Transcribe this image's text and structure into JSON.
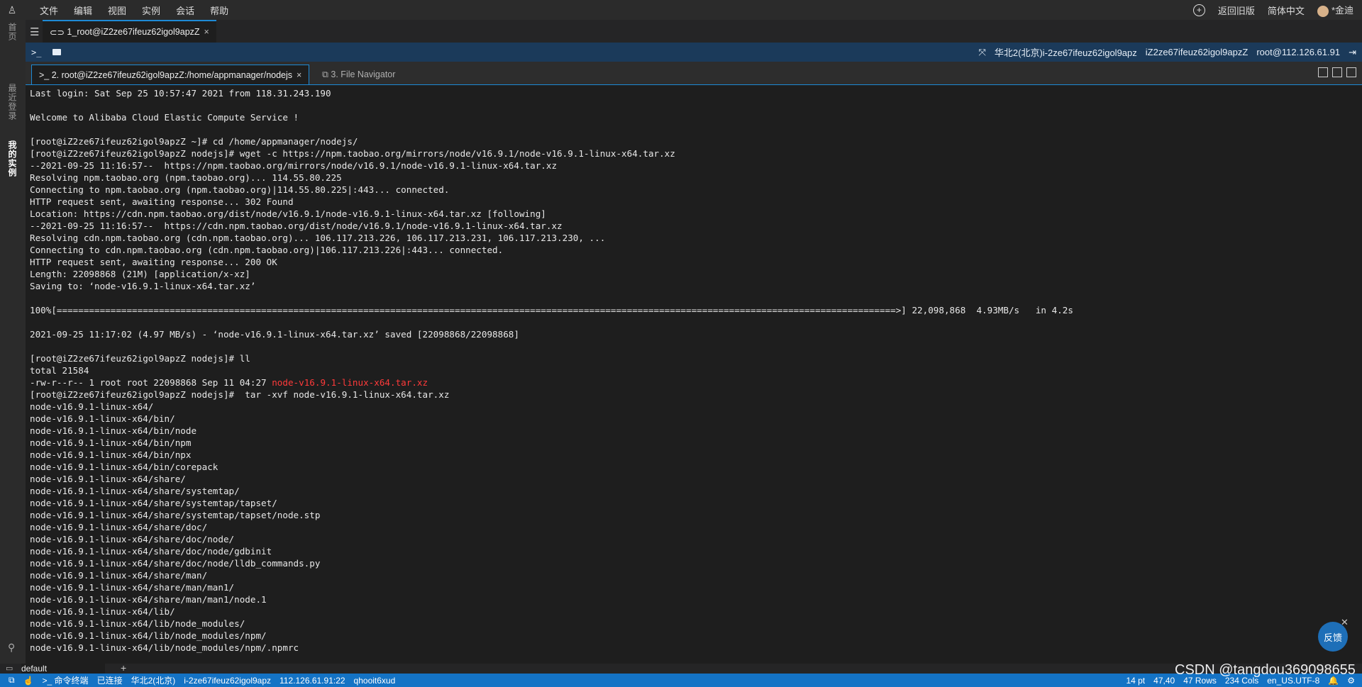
{
  "menubar": {
    "logo": "♙",
    "items": [
      "文件",
      "编辑",
      "视图",
      "实例",
      "会话",
      "帮助"
    ],
    "right": {
      "back_old": "返回旧版",
      "language": "简体中文",
      "user": "*金迪"
    }
  },
  "rail": {
    "home": "首页",
    "recent": "最近登录",
    "instances": "我的实例"
  },
  "session_tab": {
    "label": "1_root@iZ2ze67ifeuz62igol9apzZ"
  },
  "bluebar": {
    "region_instance": "华北2(北京)i-2ze67ifeuz62igol9apz",
    "hostname": "iZ2ze67ifeuz62igol9apzZ",
    "user_ip": "root@112.126.61.91"
  },
  "tabs": {
    "active": "2. root@iZ2ze67ifeuz62igol9apzZ:/home/appmanager/nodejs",
    "inactive": "3. File Navigator"
  },
  "terminal": {
    "lines": [
      "Last login: Sat Sep 25 10:57:47 2021 from 118.31.243.190",
      "",
      "Welcome to Alibaba Cloud Elastic Compute Service !",
      "",
      "[root@iZ2ze67ifeuz62igol9apzZ ~]# cd /home/appmanager/nodejs/",
      "[root@iZ2ze67ifeuz62igol9apzZ nodejs]# wget -c https://npm.taobao.org/mirrors/node/v16.9.1/node-v16.9.1-linux-x64.tar.xz",
      "--2021-09-25 11:16:57--  https://npm.taobao.org/mirrors/node/v16.9.1/node-v16.9.1-linux-x64.tar.xz",
      "Resolving npm.taobao.org (npm.taobao.org)... 114.55.80.225",
      "Connecting to npm.taobao.org (npm.taobao.org)|114.55.80.225|:443... connected.",
      "HTTP request sent, awaiting response... 302 Found",
      "Location: https://cdn.npm.taobao.org/dist/node/v16.9.1/node-v16.9.1-linux-x64.tar.xz [following]",
      "--2021-09-25 11:16:57--  https://cdn.npm.taobao.org/dist/node/v16.9.1/node-v16.9.1-linux-x64.tar.xz",
      "Resolving cdn.npm.taobao.org (cdn.npm.taobao.org)... 106.117.213.226, 106.117.213.231, 106.117.213.230, ...",
      "Connecting to cdn.npm.taobao.org (cdn.npm.taobao.org)|106.117.213.226|:443... connected.",
      "HTTP request sent, awaiting response... 200 OK",
      "Length: 22098868 (21M) [application/x-xz]",
      "Saving to: ‘node-v16.9.1-linux-x64.tar.xz’",
      "",
      "100%[============================================================================================================================================================>] 22,098,868  4.93MB/s   in 4.2s",
      "",
      "2021-09-25 11:17:02 (4.97 MB/s) - ‘node-v16.9.1-linux-x64.tar.xz’ saved [22098868/22098868]",
      "",
      "[root@iZ2ze67ifeuz62igol9apzZ nodejs]# ll",
      "total 21584",
      "-rw-r--r-- 1 root root 22098868 Sep 11 04:27 ",
      "[root@iZ2ze67ifeuz62igol9apzZ nodejs]#  tar -xvf node-v16.9.1-linux-x64.tar.xz",
      "node-v16.9.1-linux-x64/",
      "node-v16.9.1-linux-x64/bin/",
      "node-v16.9.1-linux-x64/bin/node",
      "node-v16.9.1-linux-x64/bin/npm",
      "node-v16.9.1-linux-x64/bin/npx",
      "node-v16.9.1-linux-x64/bin/corepack",
      "node-v16.9.1-linux-x64/share/",
      "node-v16.9.1-linux-x64/share/systemtap/",
      "node-v16.9.1-linux-x64/share/systemtap/tapset/",
      "node-v16.9.1-linux-x64/share/systemtap/tapset/node.stp",
      "node-v16.9.1-linux-x64/share/doc/",
      "node-v16.9.1-linux-x64/share/doc/node/",
      "node-v16.9.1-linux-x64/share/doc/node/gdbinit",
      "node-v16.9.1-linux-x64/share/doc/node/lldb_commands.py",
      "node-v16.9.1-linux-x64/share/man/",
      "node-v16.9.1-linux-x64/share/man/man1/",
      "node-v16.9.1-linux-x64/share/man/man1/node.1",
      "node-v16.9.1-linux-x64/lib/",
      "node-v16.9.1-linux-x64/lib/node_modules/",
      "node-v16.9.1-linux-x64/lib/node_modules/npm/",
      "node-v16.9.1-linux-x64/lib/node_modules/npm/.npmrc"
    ],
    "highlight": {
      "line_index": 24,
      "text": "node-v16.9.1-linux-x64.tar.xz",
      "color": "#ff3a3a"
    }
  },
  "feedback": {
    "label": "反馈"
  },
  "bottom": {
    "tab_label": "default"
  },
  "statusbar": {
    "cmd": "命令终端",
    "connected": "已连接",
    "region": "华北2(北京)",
    "instance": "i-2ze67ifeuz62igol9apz",
    "addr": "112.126.61.91:22",
    "id": "qhooit6xud",
    "font_size": "14 pt",
    "cursor": "47,40",
    "rows": "47 Rows",
    "cols": "234 Cols",
    "encoding": "en_US.UTF-8"
  },
  "watermark": "CSDN @tangdou369098655",
  "colors": {
    "accent": "#1e8ad6",
    "statusbar": "#1473c5",
    "infobar": "#1b3a5a"
  }
}
